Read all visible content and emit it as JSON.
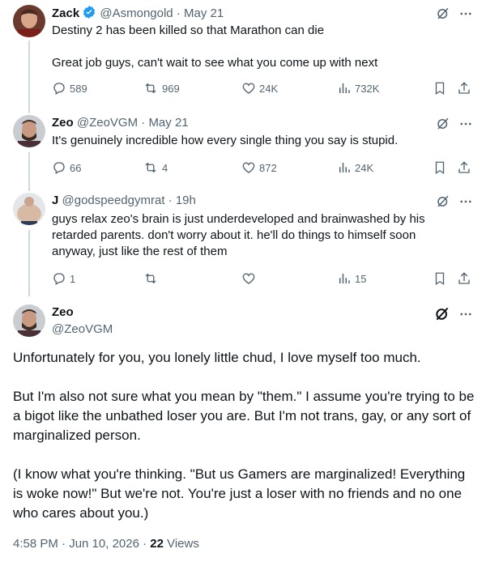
{
  "colors": {
    "accent": "#1d9bf0",
    "muted": "#536471",
    "text": "#0f1419"
  },
  "tweets": [
    {
      "name": "Zack",
      "handle": "@Asmongold",
      "sep": "·",
      "date": "May 21",
      "verified": true,
      "lines": [
        "Destiny 2 has been killed so that Marathon can die",
        "Great job guys, can't wait to see what you come up with next"
      ],
      "replies": "589",
      "reposts": "969",
      "likes": "24K",
      "views": "732K"
    },
    {
      "name": "Zeo",
      "handle": "@ZeoVGM",
      "sep": "·",
      "date": "May 21",
      "lines": [
        "It's genuinely incredible how every single thing you say is stupid."
      ],
      "replies": "66",
      "reposts": "4",
      "likes": "872",
      "views": "24K"
    },
    {
      "name": "J",
      "handle": "@godspeedgymrat",
      "sep": "·",
      "date": "19h",
      "lines": [
        "guys relax zeo's brain is just underdeveloped and brainwashed by his retarded parents. don't worry about it. he'll do things to himself soon anyway, just like the rest of them"
      ],
      "replies": "1",
      "reposts": "",
      "likes": "",
      "views": "15"
    }
  ],
  "main": {
    "name": "Zeo",
    "handle": "@ZeoVGM",
    "paragraphs": [
      "Unfortunately for you, you lonely little chud, I love myself too much.",
      "But I'm also not sure what you mean by \"them.\" I assume you're trying to be a bigot like the unbathed loser you are. But I'm not trans, gay, or any sort of marginalized person.",
      "(I know what you're thinking. \"But us Gamers are marginalized! Everything is woke now!\" But we're not. You're just a loser with no friends and no one who cares about you.)"
    ],
    "time": "4:58 PM · Jun 10, 2026 · ",
    "views_count": "22",
    "views_label": " Views"
  },
  "icons": [
    "grok-icon",
    "more-icon",
    "reply-icon",
    "repost-icon",
    "like-icon",
    "views-icon",
    "bookmark-icon",
    "share-icon",
    "verified-badge-icon"
  ]
}
